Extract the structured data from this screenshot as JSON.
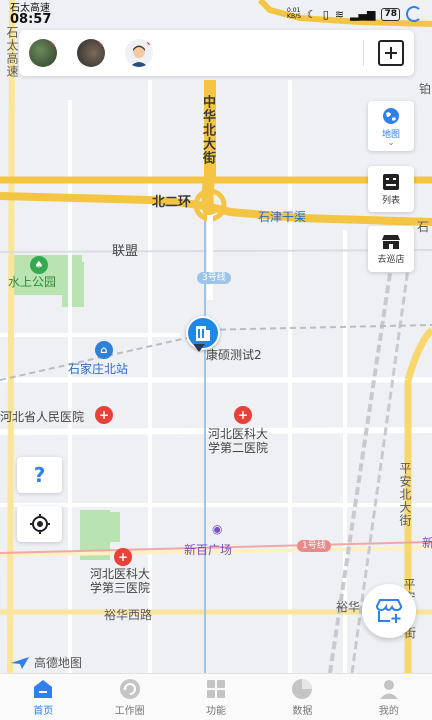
{
  "status_bar": {
    "operator": "石太高速",
    "time": "08:57",
    "net_speed": "0.01\nKB/S",
    "battery": "78"
  },
  "map": {
    "labels": {
      "zhonghua_street": "中华北大街",
      "beierhuan": "北二环",
      "shijin_canal": "石津干渠",
      "lianmeng": "联盟",
      "shuishang_park": "水上公园",
      "shijiazhuang_north": "石家庄北站",
      "kangshuo": "康硕测试2",
      "hebei_hospital": "河北省人民医院",
      "hebei_med_2": "河北医科大\n学第二医院",
      "xinbai_plaza": "新百广场",
      "hebei_med_3": "河北医科大\n学第三医院",
      "yuhua_west": "裕华西路",
      "yuhua_east": "裕华",
      "pingan_street": "平安北大街",
      "pingan_south": "平安",
      "road_edge_top": "铂",
      "road_edge_shi": "石",
      "road_edge_xin": "新",
      "road_edge_jie": "街",
      "left_edge_road": "石太高速",
      "metro_3": "3号线",
      "metro_1": "1号线"
    },
    "attribution": "高德地图"
  },
  "controls": {
    "map_label": "地图",
    "list_label": "列表",
    "visit_label": "去巡店",
    "help": "?"
  },
  "nav": [
    {
      "label": "首页",
      "icon": "home-icon",
      "active": true
    },
    {
      "label": "工作圈",
      "icon": "refresh-circle-icon",
      "active": false
    },
    {
      "label": "功能",
      "icon": "grid-icon",
      "active": false
    },
    {
      "label": "数据",
      "icon": "pie-chart-icon",
      "active": false
    },
    {
      "label": "我的",
      "icon": "user-icon",
      "active": false
    }
  ],
  "colors": {
    "accent": "#2f80ed",
    "highway": "#f4c542",
    "road": "#fff1b8"
  }
}
